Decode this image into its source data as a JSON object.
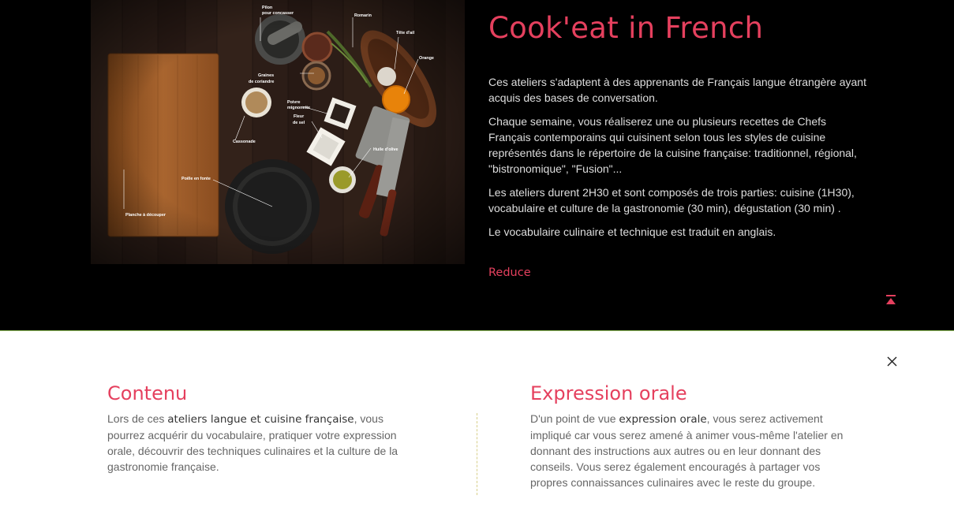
{
  "workshop": {
    "title": "Cook'eat in French",
    "paragraphs": [
      "Ces ateliers s'adaptent à des apprenants de Français langue étrangère ayant acquis des bases de conversation.",
      "Chaque semaine, vous réaliserez une ou plusieurs recettes de Chefs Français contemporains qui cuisinent selon tous les styles de cuisine représentés dans le répertoire de la cuisine française: traditionnel, régional, \"bistronomique\", \"Fusion\"...",
      "Les ateliers durent 2H30 et sont composés de trois parties: cuisine (1H30), vocabulaire et culture de la gastronomie (30 min), dégustation (30 min) .",
      "Le vocabulaire culinaire et technique est traduit en anglais."
    ],
    "reduce_label": "Reduce",
    "to_top_icon": "chevron-up-to-top-icon",
    "accent_color": "#e5405e"
  },
  "photo": {
    "labels": {
      "pilon": [
        "Pilon",
        "pour concasser"
      ],
      "romarin": "Romarin",
      "tete_ail": "Tête d'ail",
      "orange": "Orange",
      "graines": [
        "Graines",
        "de coriandre"
      ],
      "poivre": [
        "Poivre",
        "mignonette"
      ],
      "fleur": [
        "Fleur",
        "de sel"
      ],
      "cassonade": "Cassonade",
      "huile": "Huile d'olive",
      "poele": "Poêle en fonte",
      "planche": "Planche à découper"
    }
  },
  "panel": {
    "close_icon": "close-icon",
    "contenu": {
      "title": "Contenu",
      "text_1": "Lors de ces ",
      "bold": "ateliers langue et cuisine française",
      "text_2": ", vous pourrez acquérir du vocabulaire, pratiquer votre expression orale, découvrir des techniques culinaires et la culture de la gastronomie française."
    },
    "expression": {
      "title": "Expression orale",
      "text_1": "D'un point de vue ",
      "bold": "expression orale",
      "text_2": ", vous serez activement impliqué car vous serez amené à animer vous-même l'atelier en donnant des instructions aux autres ou en leur donnant des conseils. Vous serez également encouragés à partager vos propres connaissances culinaires avec le reste du groupe."
    }
  }
}
